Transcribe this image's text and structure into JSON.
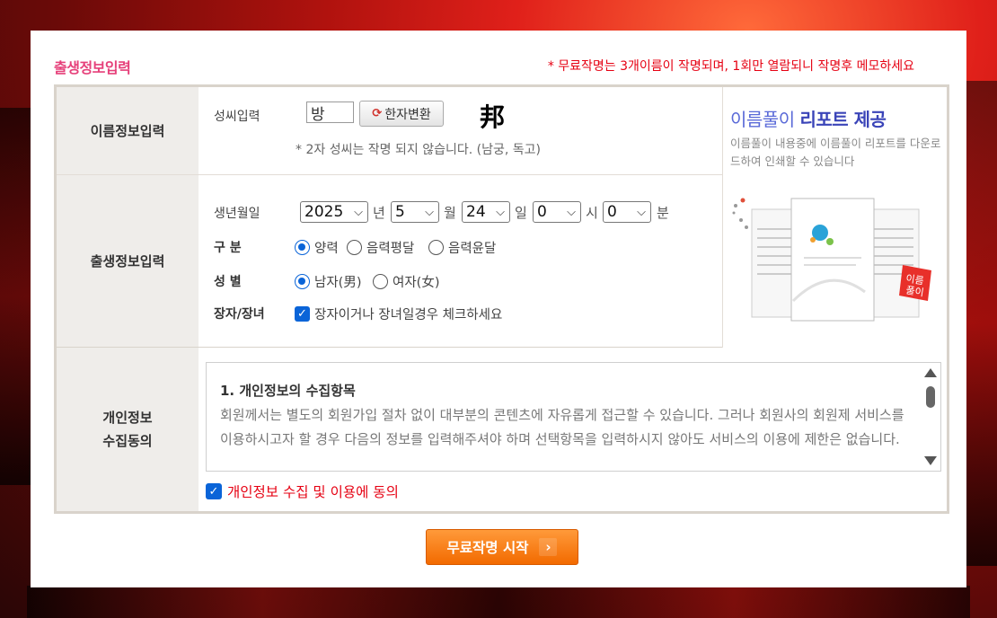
{
  "header": {
    "title": "출생정보입력",
    "notice": "* 무료작명는 3개이름이 작명되며, 1회만 열람되니 작명후 메모하세요"
  },
  "name_section": {
    "label": "이름정보입력",
    "surname_label": "성씨입력",
    "surname_value": "방",
    "hanja_button": "한자변환",
    "hanja_char": "邦",
    "note": "* 2자 성씨는 작명 되지 않습니다. (남궁, 독고)"
  },
  "birth_section": {
    "label": "출생정보입력",
    "date_label": "생년월일",
    "year": "2025",
    "year_unit": "년",
    "month": "5",
    "month_unit": "월",
    "day": "24",
    "day_unit": "일",
    "hour": "0",
    "hour_unit": "시",
    "minute": "0",
    "minute_unit": "분",
    "calendar_label": "구 분",
    "calendar_options": [
      "양력",
      "음력평달",
      "음력윤달"
    ],
    "gender_label": "성 별",
    "gender_options": [
      "남자(男)",
      "여자(女)"
    ],
    "eldest_label": "장자/장녀",
    "eldest_check_text": "장자이거나 장녀일경우 체크하세요"
  },
  "promo": {
    "title_a": "이름풀이 ",
    "title_b": "리포트 제공",
    "desc": "이름풀이 내용중에 이름풀이 리포트를 다운로드하여 인쇄할 수 있습니다",
    "badge": "이름 풀이"
  },
  "privacy_section": {
    "label_line1": "개인정보",
    "label_line2": "수집동의",
    "heading": "1. 개인정보의 수집항목",
    "body": "회원께서는 별도의 회원가입 절차 없이 대부분의 콘텐츠에 자유롭게 접근할 수 있습니다. 그러나 회원사의 회원제 서비스를 이용하시고자 할 경우 다음의 정보를 입력해주셔야 하며 선택항목을 입력하시지 않아도 서비스의 이용에 제한은 없습니다.",
    "agree_text": "개인정보 수집 및 이용에 동의"
  },
  "submit": {
    "label": "무료작명 시작"
  },
  "colors": {
    "title_pink": "#e6407a",
    "notice_red": "#e60012",
    "accent_blue": "#0a64d8",
    "button_orange": "#f26a00"
  }
}
